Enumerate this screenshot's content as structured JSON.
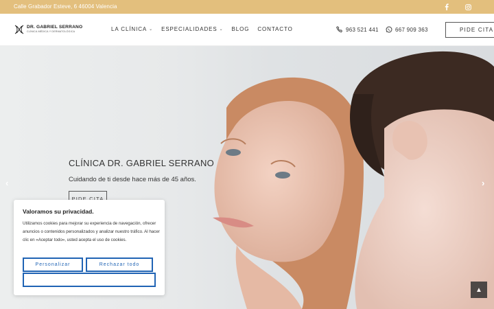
{
  "topbar": {
    "address": "Calle Grabador Esteve, 6 46004 Valencia",
    "social": [
      {
        "icon": "facebook-icon",
        "glyph": "f"
      },
      {
        "icon": "instagram-icon",
        "glyph": "◎"
      }
    ]
  },
  "header": {
    "logo": {
      "name": "DR. GABRIEL SERRANO",
      "tagline": "CLÍNICA MÉDICA Y DERMATOLÓGICA"
    },
    "nav": [
      {
        "label": "LA CLÍNICA",
        "dropdown": true
      },
      {
        "label": "ESPECIALIDADES",
        "dropdown": true
      },
      {
        "label": "BLOG",
        "dropdown": false
      },
      {
        "label": "CONTACTO",
        "dropdown": false
      }
    ],
    "phone": "963 521 441",
    "whatsapp": "667 909 363",
    "cta": "PIDE CITA"
  },
  "hero": {
    "title": "CLÍNICA DR. GABRIEL SERRANO",
    "subtitle": "Cuidando de ti desde hace más de 45 años.",
    "button": "PIDE CITA",
    "prev": "‹",
    "next": "›"
  },
  "cookie": {
    "title": "Valoramos su privacidad.",
    "text": "Utilizamos cookies para mejorar su experiencia de navegación, ofrecer anuncios o contenidos personalizados y analizar nuestro tráfico. Al hacer clic en «Aceptar todo», usted acepta el uso de cookies.",
    "customize": "Personalizar",
    "reject": "Rechazar todo",
    "accept": ""
  },
  "scroll_top": "▲",
  "colors": {
    "topbar": "#e3bf7d",
    "cookie_button": "#1f63b4"
  }
}
